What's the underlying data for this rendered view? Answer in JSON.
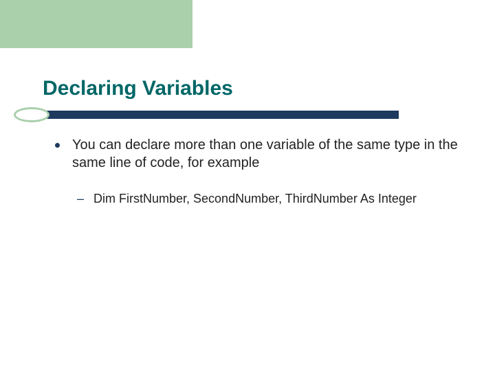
{
  "title": "Declaring Variables",
  "bullets": {
    "level1": "You can declare more than one variable of the same type in the same line of code, for example",
    "level2": "Dim FirstNumber, SecondNumber, ThirdNumber As Integer"
  }
}
